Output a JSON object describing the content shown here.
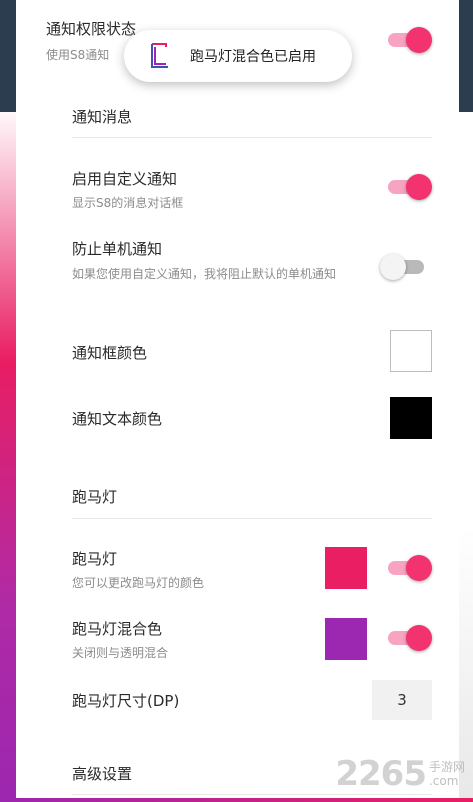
{
  "colors": {
    "accent": "#f2336f",
    "accent_track": "#f8a3c2",
    "frame_dark": "#2d3d50",
    "marquee_pink": "#e91e63",
    "marquee_purple": "#9c27b0"
  },
  "top_item": {
    "title": "通知权限状态",
    "subtitle": "使用S8通知",
    "toggle_on": true
  },
  "toast": {
    "icon": "app-logo-icon",
    "message": "跑马灯混合色已启用"
  },
  "sections": {
    "notification": {
      "header": "通知消息",
      "custom_notification": {
        "title": "启用自定义通知",
        "subtitle": "显示S8的消息对话框",
        "toggle_on": true
      },
      "block_single": {
        "title": "防止单机通知",
        "subtitle": "如果您使用自定义通知，我将阻止默认的单机通知",
        "toggle_on": false
      },
      "box_color": {
        "title": "通知框颜色",
        "color": "#ffffff"
      },
      "text_color": {
        "title": "通知文本颜色",
        "color": "#000000"
      }
    },
    "marquee": {
      "header": "跑马灯",
      "marquee_item": {
        "title": "跑马灯",
        "subtitle": "您可以更改跑马灯的颜色",
        "color": "#e91e63",
        "toggle_on": true
      },
      "mix_color": {
        "title": "跑马灯混合色",
        "subtitle": "关闭则与透明混合",
        "color": "#9c27b0",
        "toggle_on": true
      },
      "size": {
        "title": "跑马灯尺寸(DP)",
        "value": "3"
      }
    },
    "advanced": {
      "header": "高级设置"
    }
  },
  "watermark": {
    "number": "2265",
    "text": "手游网",
    "domain_text": ".com"
  }
}
